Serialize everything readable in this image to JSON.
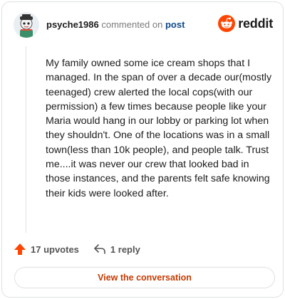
{
  "header": {
    "username": "psyche1986",
    "commented_text": "commented on",
    "post_link": "post"
  },
  "brand": {
    "name": "reddit",
    "icon": "reddit-logo-icon",
    "accent": "#ff4500"
  },
  "comment": {
    "body": "My family owned some ice cream shops that I managed. In the span of over a decade our(mostly teenaged) crew alerted the local cops(with our permission) a few times because people like your Maria would hang in our lobby or parking lot when they shouldn't. One of the locations was in a small town(less than 10k people), and people talk. Trust me....it was never our crew that looked bad in those instances, and the parents felt safe knowing their kids were looked after."
  },
  "actions": {
    "upvotes_label": "17 upvotes",
    "upvote_icon": "upvote-arrow-icon",
    "upvote_color": "#ff4500",
    "reply_label": "1 reply",
    "reply_icon": "reply-arrow-icon"
  },
  "footer": {
    "view_button_label": "View the conversation",
    "view_button_color": "#c43a00"
  }
}
